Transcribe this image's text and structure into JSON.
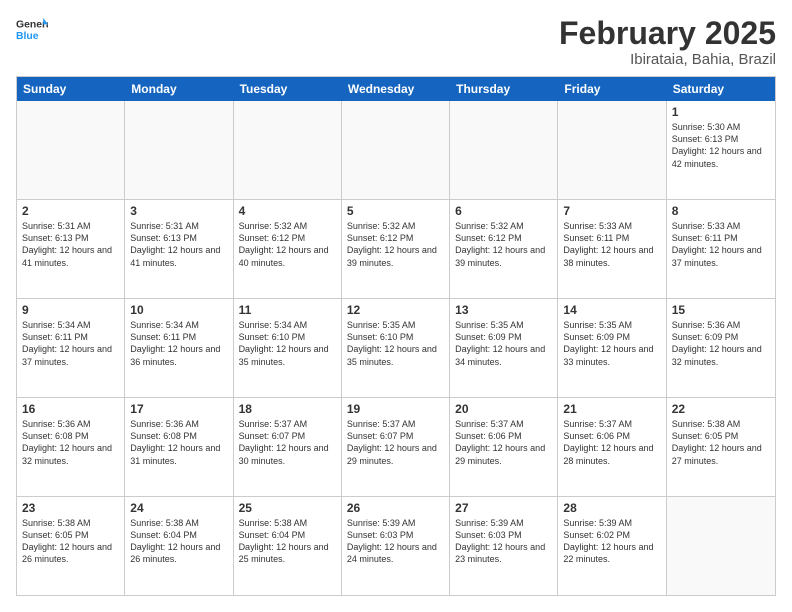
{
  "header": {
    "logo_general": "General",
    "logo_blue": "Blue",
    "month_title": "February 2025",
    "location": "Ibirataia, Bahia, Brazil"
  },
  "days_of_week": [
    "Sunday",
    "Monday",
    "Tuesday",
    "Wednesday",
    "Thursday",
    "Friday",
    "Saturday"
  ],
  "weeks": [
    [
      {
        "day": "",
        "info": ""
      },
      {
        "day": "",
        "info": ""
      },
      {
        "day": "",
        "info": ""
      },
      {
        "day": "",
        "info": ""
      },
      {
        "day": "",
        "info": ""
      },
      {
        "day": "",
        "info": ""
      },
      {
        "day": "1",
        "info": "Sunrise: 5:30 AM\nSunset: 6:13 PM\nDaylight: 12 hours and 42 minutes."
      }
    ],
    [
      {
        "day": "2",
        "info": "Sunrise: 5:31 AM\nSunset: 6:13 PM\nDaylight: 12 hours and 41 minutes."
      },
      {
        "day": "3",
        "info": "Sunrise: 5:31 AM\nSunset: 6:13 PM\nDaylight: 12 hours and 41 minutes."
      },
      {
        "day": "4",
        "info": "Sunrise: 5:32 AM\nSunset: 6:12 PM\nDaylight: 12 hours and 40 minutes."
      },
      {
        "day": "5",
        "info": "Sunrise: 5:32 AM\nSunset: 6:12 PM\nDaylight: 12 hours and 39 minutes."
      },
      {
        "day": "6",
        "info": "Sunrise: 5:32 AM\nSunset: 6:12 PM\nDaylight: 12 hours and 39 minutes."
      },
      {
        "day": "7",
        "info": "Sunrise: 5:33 AM\nSunset: 6:11 PM\nDaylight: 12 hours and 38 minutes."
      },
      {
        "day": "8",
        "info": "Sunrise: 5:33 AM\nSunset: 6:11 PM\nDaylight: 12 hours and 37 minutes."
      }
    ],
    [
      {
        "day": "9",
        "info": "Sunrise: 5:34 AM\nSunset: 6:11 PM\nDaylight: 12 hours and 37 minutes."
      },
      {
        "day": "10",
        "info": "Sunrise: 5:34 AM\nSunset: 6:11 PM\nDaylight: 12 hours and 36 minutes."
      },
      {
        "day": "11",
        "info": "Sunrise: 5:34 AM\nSunset: 6:10 PM\nDaylight: 12 hours and 35 minutes."
      },
      {
        "day": "12",
        "info": "Sunrise: 5:35 AM\nSunset: 6:10 PM\nDaylight: 12 hours and 35 minutes."
      },
      {
        "day": "13",
        "info": "Sunrise: 5:35 AM\nSunset: 6:09 PM\nDaylight: 12 hours and 34 minutes."
      },
      {
        "day": "14",
        "info": "Sunrise: 5:35 AM\nSunset: 6:09 PM\nDaylight: 12 hours and 33 minutes."
      },
      {
        "day": "15",
        "info": "Sunrise: 5:36 AM\nSunset: 6:09 PM\nDaylight: 12 hours and 32 minutes."
      }
    ],
    [
      {
        "day": "16",
        "info": "Sunrise: 5:36 AM\nSunset: 6:08 PM\nDaylight: 12 hours and 32 minutes."
      },
      {
        "day": "17",
        "info": "Sunrise: 5:36 AM\nSunset: 6:08 PM\nDaylight: 12 hours and 31 minutes."
      },
      {
        "day": "18",
        "info": "Sunrise: 5:37 AM\nSunset: 6:07 PM\nDaylight: 12 hours and 30 minutes."
      },
      {
        "day": "19",
        "info": "Sunrise: 5:37 AM\nSunset: 6:07 PM\nDaylight: 12 hours and 29 minutes."
      },
      {
        "day": "20",
        "info": "Sunrise: 5:37 AM\nSunset: 6:06 PM\nDaylight: 12 hours and 29 minutes."
      },
      {
        "day": "21",
        "info": "Sunrise: 5:37 AM\nSunset: 6:06 PM\nDaylight: 12 hours and 28 minutes."
      },
      {
        "day": "22",
        "info": "Sunrise: 5:38 AM\nSunset: 6:05 PM\nDaylight: 12 hours and 27 minutes."
      }
    ],
    [
      {
        "day": "23",
        "info": "Sunrise: 5:38 AM\nSunset: 6:05 PM\nDaylight: 12 hours and 26 minutes."
      },
      {
        "day": "24",
        "info": "Sunrise: 5:38 AM\nSunset: 6:04 PM\nDaylight: 12 hours and 26 minutes."
      },
      {
        "day": "25",
        "info": "Sunrise: 5:38 AM\nSunset: 6:04 PM\nDaylight: 12 hours and 25 minutes."
      },
      {
        "day": "26",
        "info": "Sunrise: 5:39 AM\nSunset: 6:03 PM\nDaylight: 12 hours and 24 minutes."
      },
      {
        "day": "27",
        "info": "Sunrise: 5:39 AM\nSunset: 6:03 PM\nDaylight: 12 hours and 23 minutes."
      },
      {
        "day": "28",
        "info": "Sunrise: 5:39 AM\nSunset: 6:02 PM\nDaylight: 12 hours and 22 minutes."
      },
      {
        "day": "",
        "info": ""
      }
    ]
  ]
}
